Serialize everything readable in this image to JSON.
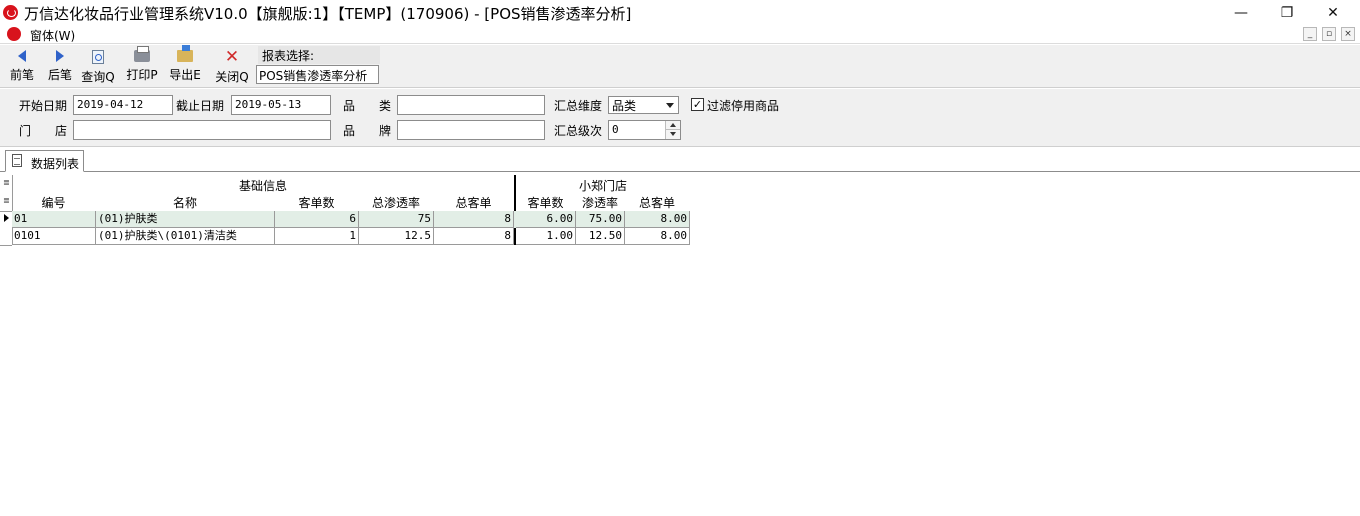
{
  "window": {
    "title": "万信达化妆品行业管理系统V10.0【旗舰版:1】【TEMP】(170906) - [POS销售渗透率分析]",
    "minimize": "—",
    "maximize": "❐",
    "close": "✕"
  },
  "menubar": {
    "window_menu": "窗体(W)",
    "mdi_min": "_",
    "mdi_restore": "▫",
    "mdi_close": "×"
  },
  "toolbar": {
    "prev": "前笔",
    "next": "后笔",
    "query": "查询Q",
    "print": "打印P",
    "export": "导出E",
    "close": "关闭Q",
    "report_label": "报表选择:",
    "report_value": "POS销售渗透率分析"
  },
  "filters": {
    "start_date_label": "开始日期",
    "start_date": "2019-04-12",
    "end_date_label": "截止日期",
    "end_date": "2019-05-13",
    "category_label": "品　　类",
    "category_value": "",
    "summary_dim_label": "汇总维度",
    "summary_dim_value": "品类",
    "filter_disabled_label": "过滤停用商品",
    "filter_disabled_checked": "✓",
    "store_label": "门　　店",
    "store_value": "",
    "brand_label": "品　　牌",
    "brand_value": "",
    "summary_level_label": "汇总级次",
    "summary_level_value": "0"
  },
  "tabs": {
    "data_list": "数据列表"
  },
  "grid": {
    "group_basic": "基础信息",
    "group_store": "小郑门店",
    "columns": [
      "编号",
      "名称",
      "客单数",
      "总渗透率",
      "总客单",
      "客单数",
      "渗透率",
      "总客单"
    ],
    "rows": [
      [
        "01",
        "(01)护肤类",
        "6",
        "75",
        "8",
        "6.00",
        "75.00",
        "8.00"
      ],
      [
        "0101",
        "(01)护肤类\\(0101)清洁类",
        "1",
        "12.5",
        "8",
        "1.00",
        "12.50",
        "8.00"
      ]
    ]
  }
}
